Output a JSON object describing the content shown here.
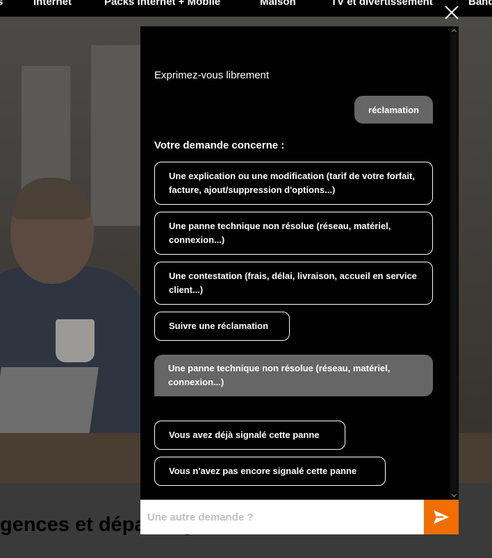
{
  "nav": {
    "items": [
      "s",
      "Internet",
      "Packs Internet + Mobile",
      "Maison",
      "TV et divertissement",
      "Banq"
    ]
  },
  "page": {
    "section_title": "gences et dépannage"
  },
  "chat": {
    "intro": "Exprimez-vous librement",
    "user_message": "réclamation",
    "question": "Votre demande concerne :",
    "options": [
      "Une explication ou une modification (tarif de votre forfait, facture, ajout/suppression d'options...)",
      "Une panne technique non résolue (réseau, matériel, connexion...)",
      "Une contestation (frais, délai, livraison, accueil en service client...)",
      "Suivre une réclamation"
    ],
    "selected_echo": "Une panne technique non résolue (réseau, matériel, connexion...)",
    "followups": [
      "Vous avez déjà signalé cette panne",
      "Vous n'avez pas encore signalé cette panne"
    ],
    "input_placeholder": "Une autre demande ?"
  },
  "colors": {
    "send_button": "#f16e00",
    "chat_background": "#000000",
    "bubble_gray": "#666666"
  },
  "icons": {
    "close": "close-icon",
    "send": "send-icon",
    "scroll_up": "chevron-up-icon",
    "scroll_down": "chevron-down-icon"
  }
}
